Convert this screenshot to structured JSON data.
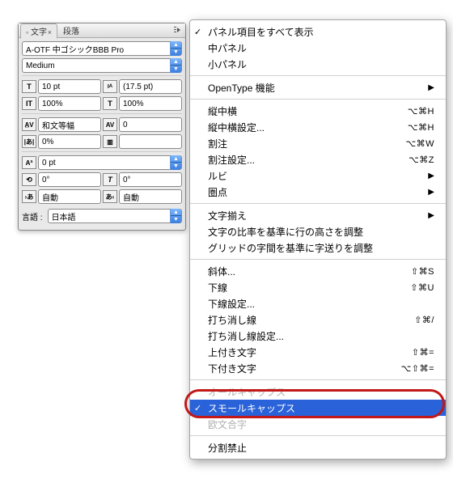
{
  "panel": {
    "tabs": {
      "moji": "文字",
      "danraku": "段落"
    },
    "font": "A-OTF 中ゴシックBBB Pro",
    "weight": "Medium",
    "size": "10 pt",
    "leading": "(17.5 pt)",
    "vscale": "100%",
    "hscale": "100%",
    "kerning_mode": "和文等幅",
    "tracking": "0",
    "tsume": "0%",
    "aki_before": "自動",
    "aki_after": "自動",
    "baseline": "0 pt",
    "skew": "0°",
    "rotate": "0°",
    "language_label": "言語 :",
    "language": "日本語"
  },
  "menu": {
    "show_all": "パネル項目をすべて表示",
    "mid_panel": "中パネル",
    "small_panel": "小パネル",
    "opentype": "OpenType 機能",
    "tcy": "縦中横",
    "tcy_settings": "縦中横設定...",
    "warichu": "割注",
    "warichu_settings": "割注設定...",
    "ruby": "ルビ",
    "kenten": "圏点",
    "moji_soroe": "文字揃え",
    "ratio_line_height": "文字の比率を基準に行の高さを調整",
    "grid_jioku": "グリッドの字間を基準に字送りを調整",
    "italic": "斜体...",
    "underline": "下線",
    "underline_settings": "下線設定...",
    "strike": "打ち消し線",
    "strike_settings": "打ち消し線設定...",
    "superscript": "上付き文字",
    "subscript": "下付き文字",
    "all_caps": "オールキャップス",
    "small_caps": "スモールキャップス",
    "ligature": "欧文合字",
    "no_break": "分割禁止",
    "sc": {
      "tcy": "⌥⌘H",
      "tcy_settings": "⌥⌘H",
      "warichu": "⌥⌘W",
      "warichu_settings": "⌥⌘Z",
      "italic": "⇧⌘S",
      "underline": "⇧⌘U",
      "strike": "⇧⌘/",
      "superscript": "⇧⌘=",
      "subscript": "⌥⇧⌘="
    }
  }
}
